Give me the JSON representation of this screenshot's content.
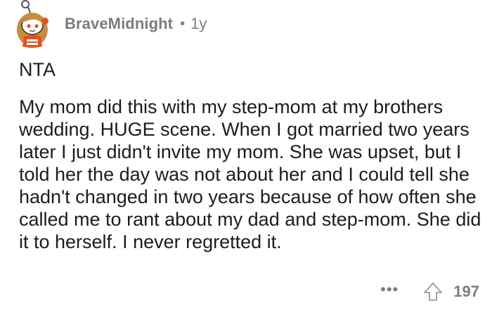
{
  "comment": {
    "author": "BraveMidnight",
    "separator": "•",
    "age": "1y",
    "verdict": "NTA",
    "body": "My mom did this with my step-mom at my brothers wedding. HUGE scene. When I got married two years later I just didn't invite my mom. She was upset, but I told her the day was not about her and I could tell she hadn't changed in two years because of how often she called me to rant about my dad and step-mom. She did it to herself. I never regretted it.",
    "more_label": "•••",
    "score": "197"
  },
  "icons": {
    "avatar": "snoo-avatar-icon",
    "more": "more-options-icon",
    "upvote": "upvote-arrow-icon"
  },
  "colors": {
    "text": "#1c1c1c",
    "muted": "#7c7c7c",
    "avatar_orange": "#e8511f",
    "avatar_hair": "#c98b3e"
  }
}
